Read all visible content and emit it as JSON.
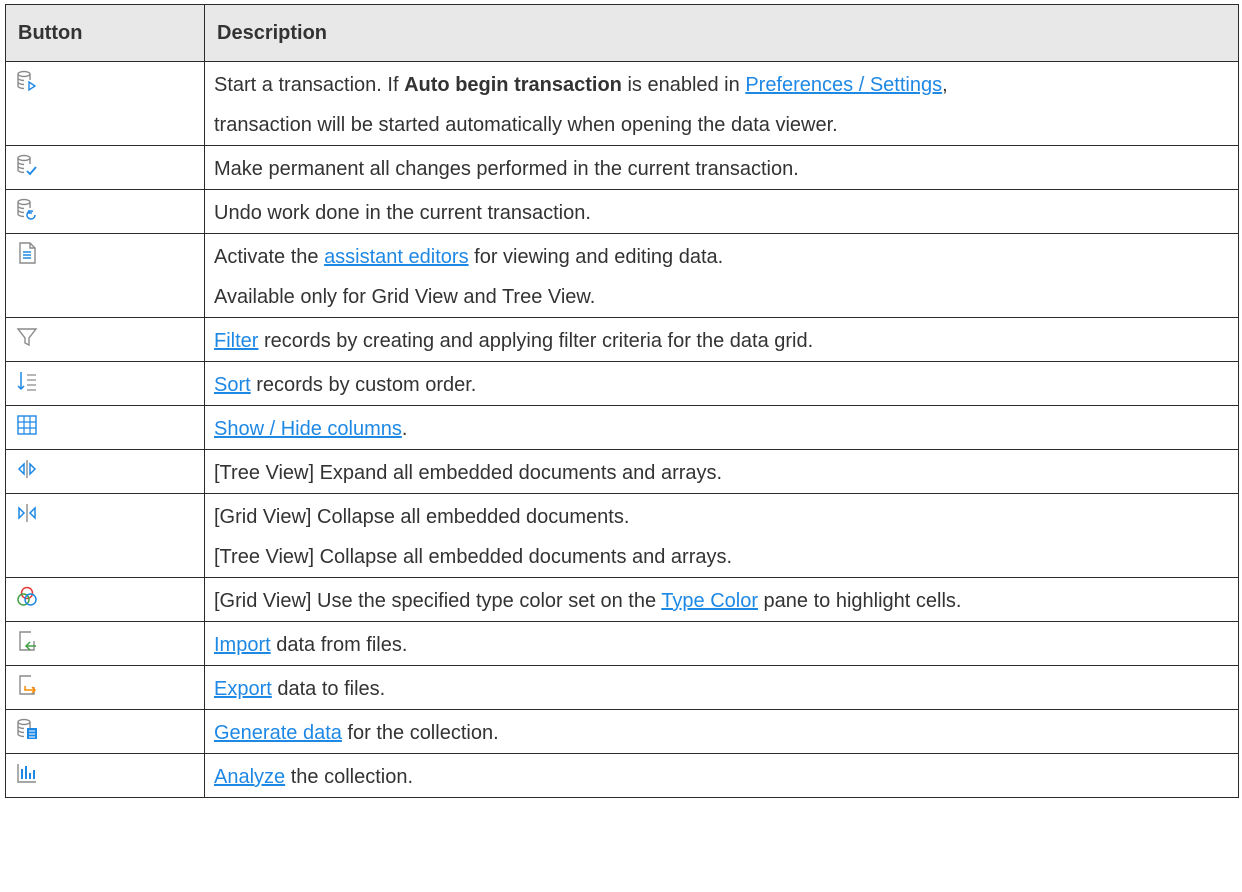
{
  "table": {
    "headers": {
      "button": "Button",
      "description": "Description"
    },
    "rows": [
      {
        "icon": "begin-transaction-icon",
        "lines": [
          {
            "parts": [
              {
                "t": "Start a transaction. If "
              },
              {
                "t": "Auto begin transaction",
                "b": true
              },
              {
                "t": " is enabled in "
              },
              {
                "t": "Preferences / Settings",
                "link": true
              },
              {
                "t": ","
              }
            ]
          },
          {
            "parts": [
              {
                "t": "transaction will be started automatically when opening the data viewer."
              }
            ]
          }
        ]
      },
      {
        "icon": "commit-icon",
        "lines": [
          {
            "parts": [
              {
                "t": "Make permanent all changes performed in the current transaction."
              }
            ]
          }
        ]
      },
      {
        "icon": "rollback-icon",
        "lines": [
          {
            "parts": [
              {
                "t": "Undo work done in the current transaction."
              }
            ]
          }
        ]
      },
      {
        "icon": "assistant-editor-icon",
        "lines": [
          {
            "parts": [
              {
                "t": "Activate the "
              },
              {
                "t": "assistant editors",
                "link": true
              },
              {
                "t": " for viewing and editing data."
              }
            ]
          },
          {
            "parts": [
              {
                "t": "Available only for Grid View and Tree View."
              }
            ]
          }
        ]
      },
      {
        "icon": "filter-icon",
        "lines": [
          {
            "parts": [
              {
                "t": "Filter",
                "link": true
              },
              {
                "t": " records by creating and applying filter criteria for the data grid."
              }
            ]
          }
        ]
      },
      {
        "icon": "sort-icon",
        "lines": [
          {
            "parts": [
              {
                "t": "Sort",
                "link": true
              },
              {
                "t": " records by custom order."
              }
            ]
          }
        ]
      },
      {
        "icon": "columns-grid-icon",
        "lines": [
          {
            "parts": [
              {
                "t": "Show / Hide columns",
                "link": true
              },
              {
                "t": "."
              }
            ]
          }
        ]
      },
      {
        "icon": "expand-all-icon",
        "lines": [
          {
            "parts": [
              {
                "t": "[Tree View] Expand all embedded documents and arrays."
              }
            ]
          }
        ]
      },
      {
        "icon": "collapse-all-icon",
        "lines": [
          {
            "parts": [
              {
                "t": "[Grid View] Collapse all embedded documents."
              }
            ]
          },
          {
            "parts": [
              {
                "t": "[Tree View] Collapse all embedded documents and arrays."
              }
            ]
          }
        ]
      },
      {
        "icon": "type-color-icon",
        "lines": [
          {
            "parts": [
              {
                "t": "[Grid View] Use the specified type color set on the "
              },
              {
                "t": "Type Color",
                "link": true
              },
              {
                "t": " pane to highlight cells."
              }
            ]
          }
        ]
      },
      {
        "icon": "import-icon",
        "lines": [
          {
            "parts": [
              {
                "t": "Import",
                "link": true
              },
              {
                "t": " data from files."
              }
            ]
          }
        ]
      },
      {
        "icon": "export-icon",
        "lines": [
          {
            "parts": [
              {
                "t": "Export",
                "link": true
              },
              {
                "t": " data to files."
              }
            ]
          }
        ]
      },
      {
        "icon": "generate-data-icon",
        "lines": [
          {
            "parts": [
              {
                "t": "Generate data",
                "link": true
              },
              {
                "t": " for the collection."
              }
            ]
          }
        ]
      },
      {
        "icon": "analyze-icon",
        "lines": [
          {
            "parts": [
              {
                "t": "Analyze",
                "link": true
              },
              {
                "t": " the collection."
              }
            ]
          }
        ]
      }
    ]
  },
  "colors": {
    "link": "#1e88e5",
    "icon": "#8a8a8a",
    "icon_accent": "#1e88e5",
    "header_bg": "#e8e8e8"
  }
}
